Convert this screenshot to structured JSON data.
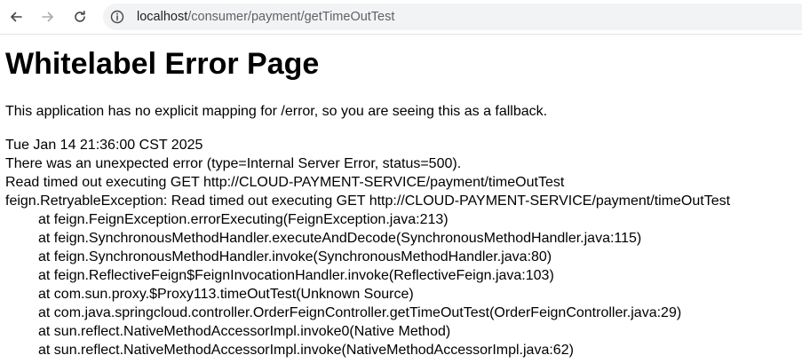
{
  "browser": {
    "url_host": "localhost",
    "url_path": "/consumer/payment/getTimeOutTest"
  },
  "page": {
    "title": "Whitelabel Error Page",
    "explanation": "This application has no explicit mapping for /error, so you are seeing this as a fallback.",
    "timestamp": "Tue Jan 14 21:36:00 CST 2025",
    "error_summary": "There was an unexpected error (type=Internal Server Error, status=500).",
    "message": "Read timed out executing GET http://CLOUD-PAYMENT-SERVICE/payment/timeOutTest",
    "exception": "feign.RetryableException: Read timed out executing GET http://CLOUD-PAYMENT-SERVICE/payment/timeOutTest",
    "stack_trace": [
      "at feign.FeignException.errorExecuting(FeignException.java:213)",
      "at feign.SynchronousMethodHandler.executeAndDecode(SynchronousMethodHandler.java:115)",
      "at feign.SynchronousMethodHandler.invoke(SynchronousMethodHandler.java:80)",
      "at feign.ReflectiveFeign$FeignInvocationHandler.invoke(ReflectiveFeign.java:103)",
      "at com.sun.proxy.$Proxy113.timeOutTest(Unknown Source)",
      "at com.java.springcloud.controller.OrderFeignController.getTimeOutTest(OrderFeignController.java:29)",
      "at sun.reflect.NativeMethodAccessorImpl.invoke0(Native Method)",
      "at sun.reflect.NativeMethodAccessorImpl.invoke(NativeMethodAccessorImpl.java:62)"
    ]
  }
}
